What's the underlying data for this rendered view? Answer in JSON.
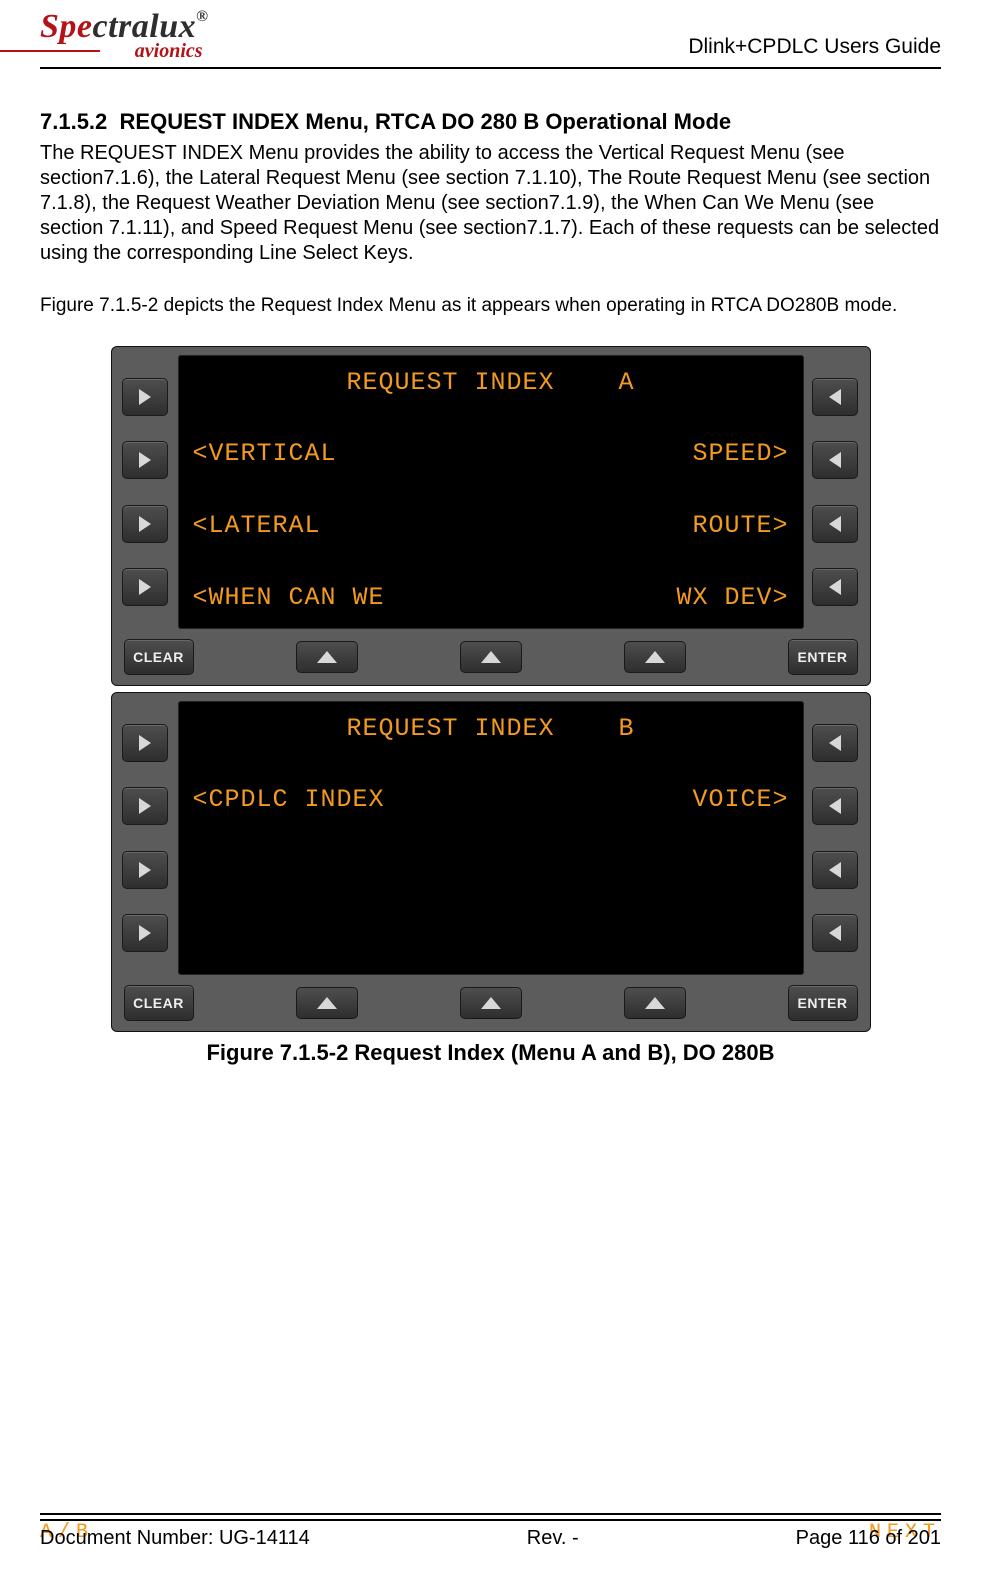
{
  "header": {
    "logo_main_red": "Spe",
    "logo_main_dark": "ctralux",
    "logo_sub": "avionics",
    "doc_title": "Dlink+CPDLC Users Guide"
  },
  "section": {
    "number": "7.1.5.2",
    "title": "REQUEST INDEX Menu, RTCA DO 280 B Operational Mode",
    "paragraph": "The REQUEST INDEX Menu provides the ability to access the Vertical Request Menu (see section7.1.6), the Lateral Request Menu (see section 7.1.10), The Route Request Menu (see section 7.1.8), the Request Weather Deviation Menu (see section7.1.9), the When Can We Menu (see section 7.1.11), and Speed Request Menu (see section7.1.7).  Each of these requests can be selected using the corresponding Line Select Keys.",
    "figure_intro": "Figure 7.1.5-2 depicts the Request Index Menu as it appears when operating in RTCA DO280B mode."
  },
  "screens": [
    {
      "title": "REQUEST INDEX    A",
      "rows": [
        {
          "left": "<VERTICAL",
          "right": "SPEED>"
        },
        {
          "left": "<LATERAL",
          "right": "ROUTE>"
        },
        {
          "left": "<WHEN CAN WE",
          "right": "WX DEV>"
        }
      ],
      "footer_left": "A/B",
      "footer_right": "NEXT"
    },
    {
      "title": "REQUEST INDEX    B",
      "rows": [
        {
          "left": "<CPDLC INDEX",
          "right": "VOICE>"
        },
        {
          "left": " ",
          "right": " "
        },
        {
          "left": " ",
          "right": " "
        }
      ],
      "footer_left": "A/B",
      "footer_right": "NEXT"
    }
  ],
  "buttons": {
    "clear": "CLEAR",
    "enter": "ENTER"
  },
  "caption": "Figure 7.1.5-2 Request Index (Menu A and B), DO 280B",
  "footer": {
    "doc_num": "Document Number:  UG-14114",
    "rev": "Rev. -",
    "page": "Page 116 of 201"
  }
}
